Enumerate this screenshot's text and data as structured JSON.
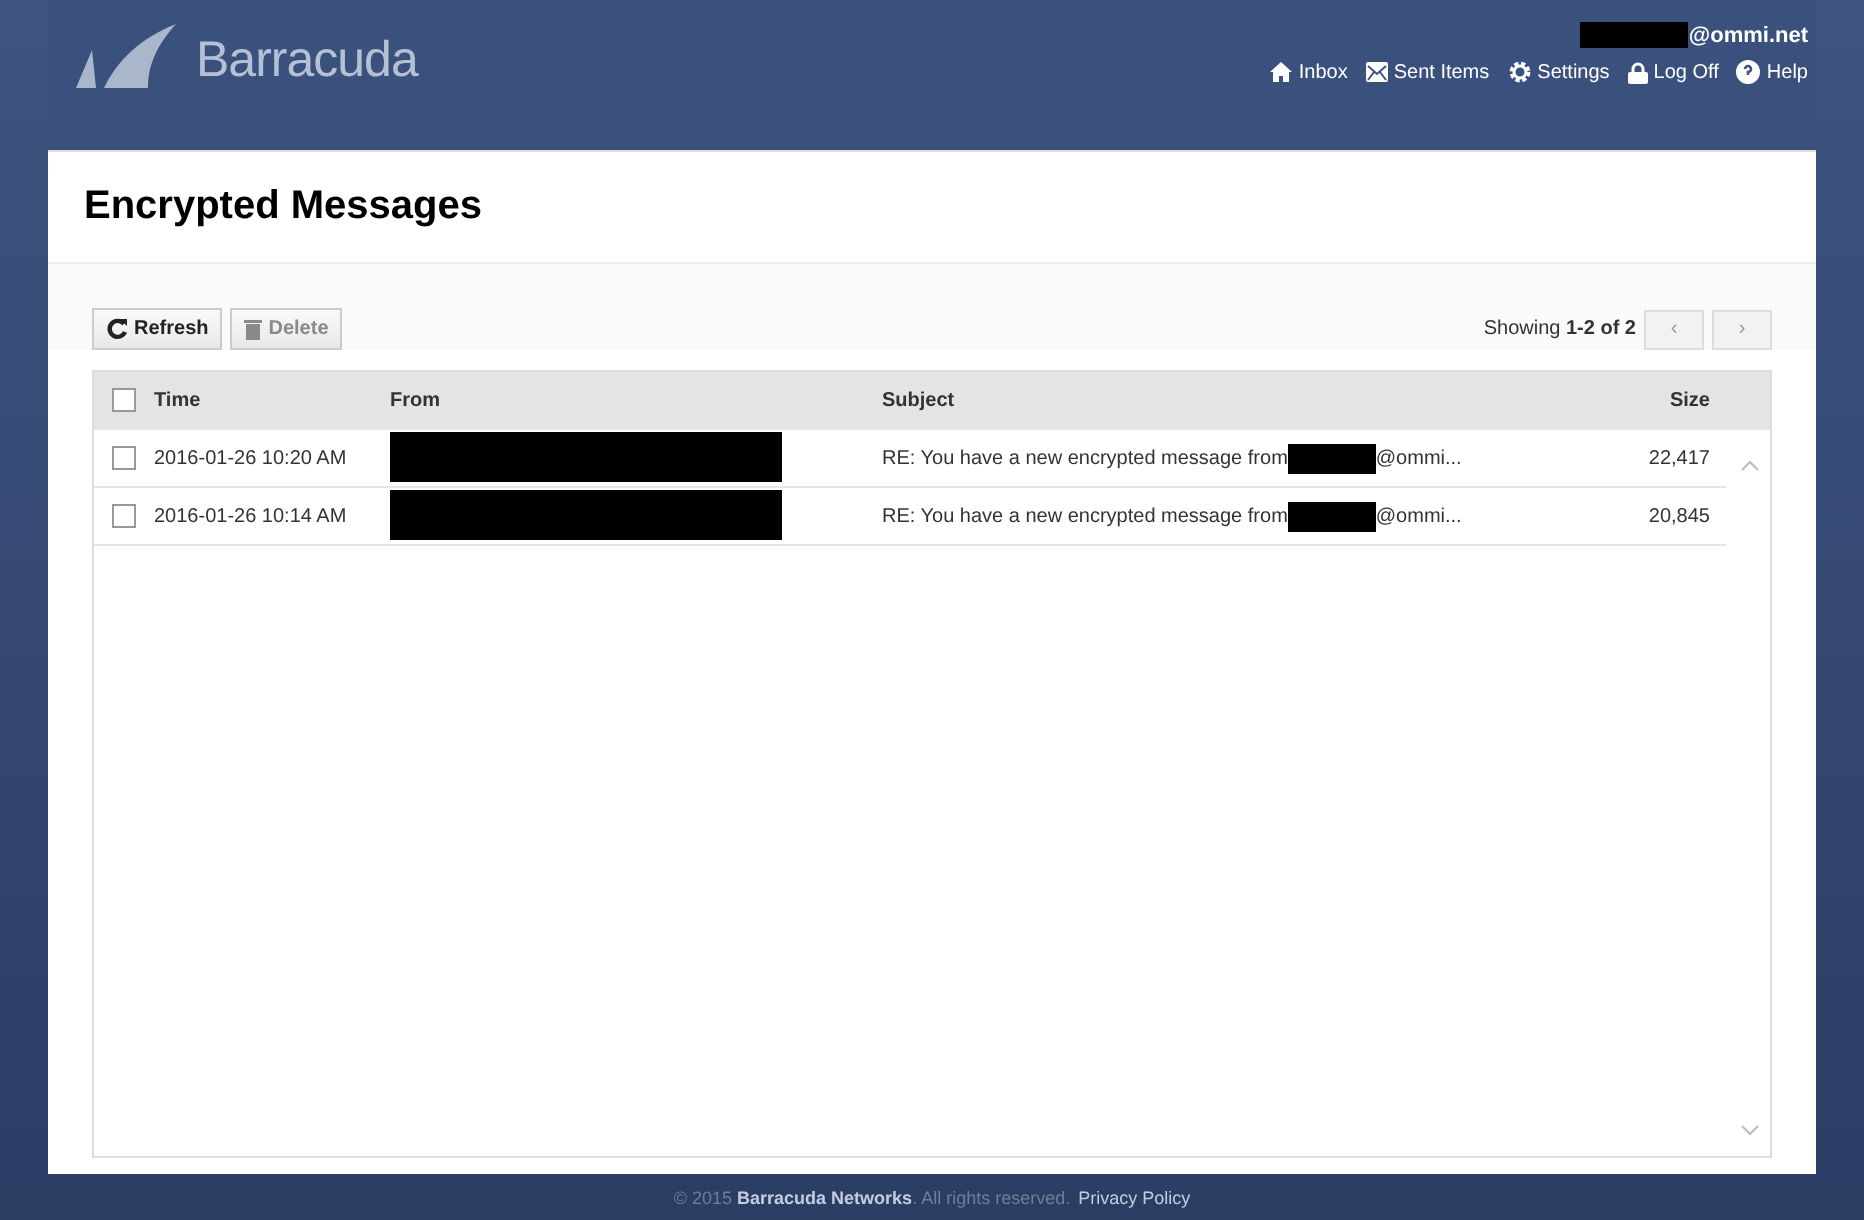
{
  "header": {
    "logo": "Barracuda",
    "user": "@ommi.net",
    "nav": [
      {
        "label": "Inbox",
        "kind": "home"
      },
      {
        "label": "Sent Items",
        "kind": "mail"
      },
      {
        "label": "Settings",
        "kind": "gear"
      },
      {
        "label": "Log Off",
        "kind": "lock"
      },
      {
        "label": "Help",
        "kind": "help"
      }
    ]
  },
  "title": "Encrypted Messages",
  "toolbar": {
    "buttons": [
      {
        "label": "Refresh",
        "kind": "refresh",
        "disabled": false
      },
      {
        "label": "Delete",
        "kind": "trash",
        "disabled": true
      }
    ],
    "paging": "Showing **1-2 of 2**",
    "prev": "‹",
    "next": "›"
  },
  "table": {
    "columns": [
      "Time",
      "From",
      "Subject",
      "Size"
    ],
    "all_checked": false,
    "rows": [
      {
        "checked": false,
        "time": "2016-01-26 10:20 AM",
        "subject": "RE: You have a new encrypted message from",
        "subject_end": "@ommi...",
        "size": "22,417"
      },
      {
        "checked": false,
        "time": "2016-01-26 10:14 AM",
        "subject": "RE: You have a new encrypted message from",
        "subject_end": "@ommi...",
        "size": "20,845"
      }
    ]
  },
  "footer": {
    "text": "© 2015 **Barracuda Networks**. All rights reserved.",
    "link": "Privacy Policy"
  }
}
